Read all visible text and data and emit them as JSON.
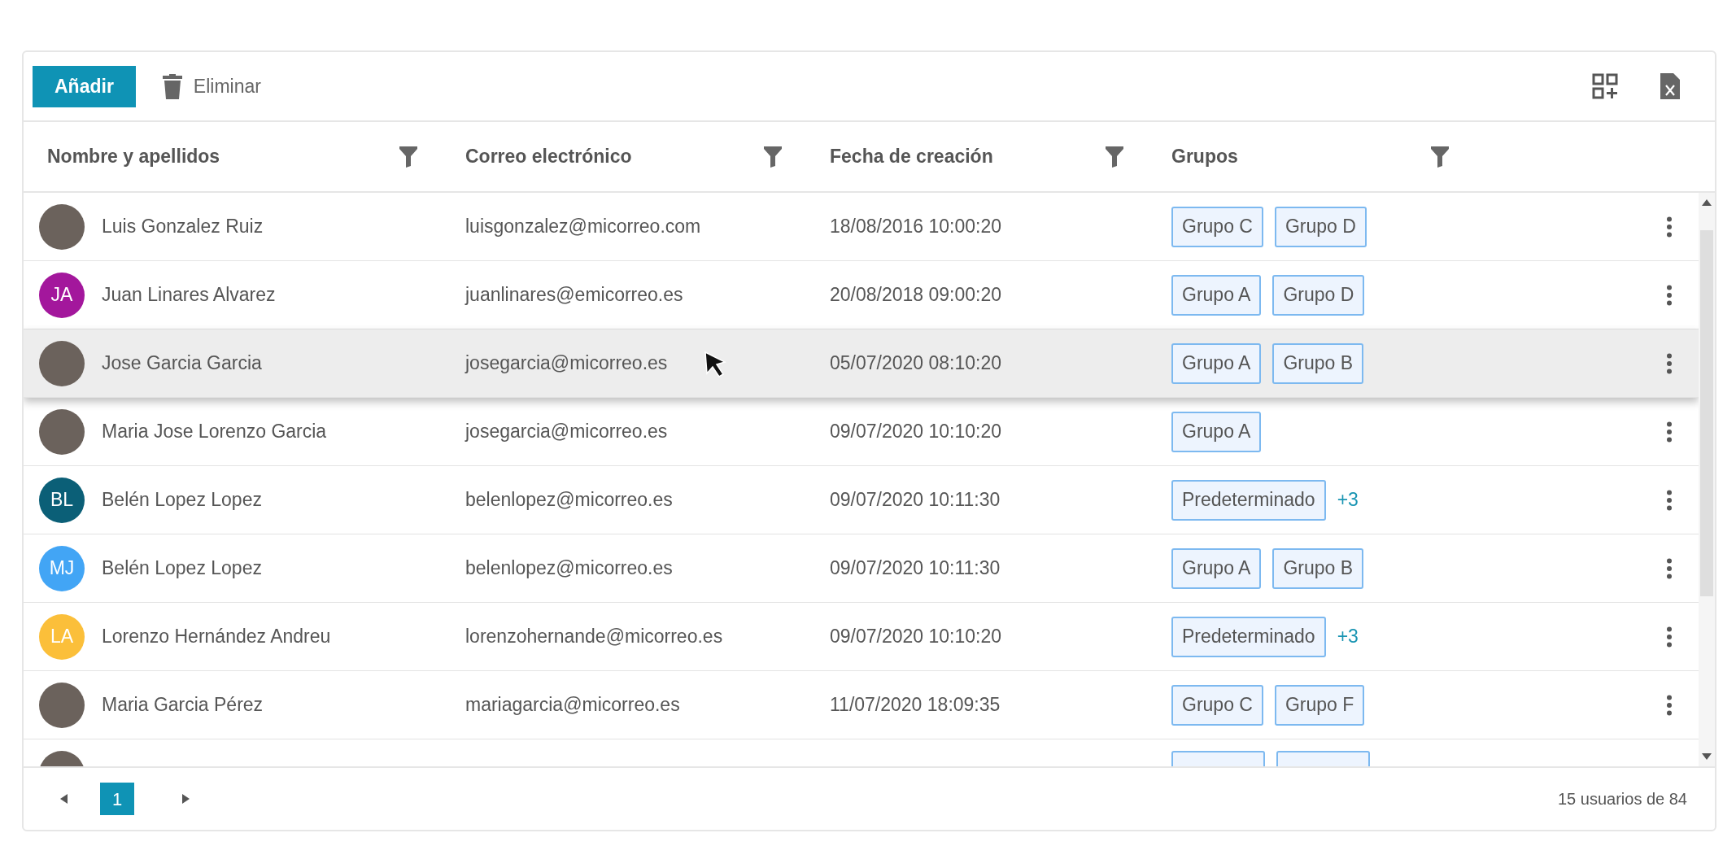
{
  "toolbar": {
    "add_button": "Añadir",
    "delete_button": "Eliminar"
  },
  "columns": [
    {
      "label": "Nombre y apellidos"
    },
    {
      "label": "Correo electrónico"
    },
    {
      "label": "Fecha de creación"
    },
    {
      "label": "Grupos"
    }
  ],
  "rows": [
    {
      "avatar": {
        "kind": "photo"
      },
      "name": "Luis Gonzalez Ruiz",
      "email": "luisgonzalez@micorreo.com",
      "date": "18/08/2016 10:00:20",
      "groups": [
        "Grupo C",
        "Grupo D"
      ],
      "hovered": false
    },
    {
      "avatar": {
        "kind": "initials",
        "initials": "JA",
        "color": "#a3179c"
      },
      "name": "Juan Linares Alvarez",
      "email": "juanlinares@emicorreo.es",
      "date": "20/08/2018 09:00:20",
      "groups": [
        "Grupo A",
        "Grupo D"
      ],
      "hovered": false
    },
    {
      "avatar": {
        "kind": "photo"
      },
      "name": "Jose Garcia Garcia",
      "email": "josegarcia@micorreo.es",
      "date": "05/07/2020 08:10:20",
      "groups": [
        "Grupo A",
        "Grupo B"
      ],
      "hovered": true
    },
    {
      "avatar": {
        "kind": "photo"
      },
      "name": "Maria Jose Lorenzo Garcia",
      "email": "josegarcia@micorreo.es",
      "date": "09/07/2020 10:10:20",
      "groups": [
        "Grupo A"
      ],
      "hovered": false
    },
    {
      "avatar": {
        "kind": "initials",
        "initials": "BL",
        "color": "#0b5f77"
      },
      "name": "Belén Lopez Lopez",
      "email": "belenlopez@micorreo.es",
      "date": "09/07/2020 10:11:30",
      "groups": [
        "Predeterminado"
      ],
      "more": "+3",
      "hovered": false
    },
    {
      "avatar": {
        "kind": "initials",
        "initials": "MJ",
        "color": "#42a5f5"
      },
      "name": "Belén Lopez Lopez",
      "email": "belenlopez@micorreo.es",
      "date": "09/07/2020 10:11:30",
      "groups": [
        "Grupo A",
        "Grupo B"
      ],
      "hovered": false
    },
    {
      "avatar": {
        "kind": "initials",
        "initials": "LA",
        "color": "#fbbf3a"
      },
      "name": "Lorenzo Hernández Andreu",
      "email": "lorenzohernande@micorreo.es",
      "date": "09/07/2020 10:10:20",
      "groups": [
        "Predeterminado"
      ],
      "more": "+3",
      "hovered": false
    },
    {
      "avatar": {
        "kind": "photo"
      },
      "name": "Maria Garcia Pérez",
      "email": "mariagarcia@micorreo.es",
      "date": "11/07/2020 18:09:35",
      "groups": [
        "Grupo C",
        "Grupo F"
      ],
      "hovered": false
    }
  ],
  "pagination": {
    "pages": [
      {
        "label": "1",
        "selected": true
      }
    ],
    "summary": "15 usuarios de 84"
  }
}
